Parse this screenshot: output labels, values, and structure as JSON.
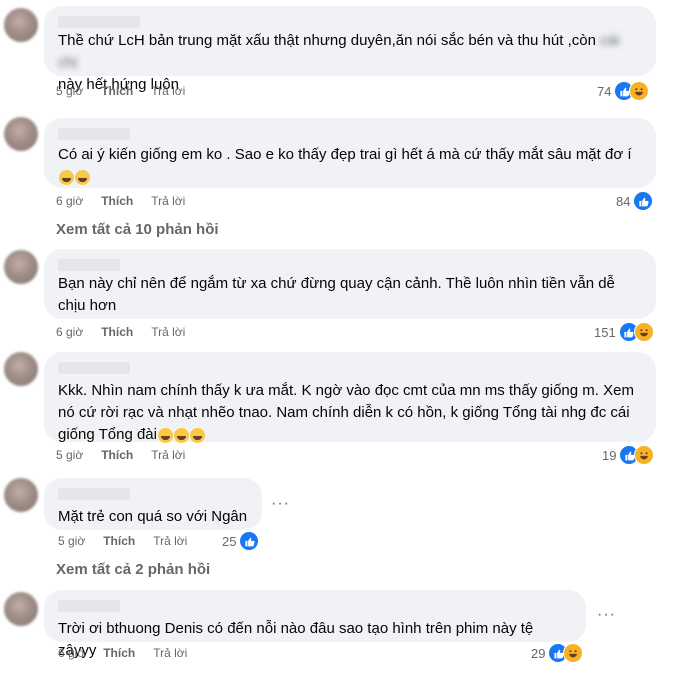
{
  "comments": [
    {
      "text": "Thề chứ LcH bản trung mặt xấu thật nhưng duyên,ăn nói sắc bén và thu hút ,còn",
      "text_blurred": "cái chị",
      "text2": "này hết hứng luôn",
      "time": "5 giờ",
      "like": "Thích",
      "reply": "Trả lời",
      "reaction_count": "74",
      "reactions": [
        "like-icon",
        "haha-icon"
      ]
    },
    {
      "text": "Có ai ý kiến giống em ko . Sao e ko thấy đẹp trai gì hết á mà cứ thấy mắt sâu mặt đơ í",
      "emojis": [
        "sad-icon",
        "sad-icon"
      ],
      "time": "6 giờ",
      "like": "Thích",
      "reply": "Trả lời",
      "reaction_count": "84",
      "reactions": [
        "like-icon"
      ]
    },
    {
      "text": "Bạn này chỉ nên để ngắm từ xa chứ đừng quay cận cảnh. Thề luôn nhìn tiền vẫn dễ chịu hơn",
      "time": "6 giờ",
      "like": "Thích",
      "reply": "Trả lời",
      "reaction_count": "151",
      "reactions": [
        "like-icon",
        "haha-icon"
      ]
    },
    {
      "text": "Kkk. Nhìn nam chính thấy k ưa mắt. K ngờ vào đọc cmt của mn ms thấy giống m. Xem nó cứ rời rạc và nhạt nhẽo tnao. Nam chính diễn k có hồn, k giống Tổng tài nhg đc cái giống Tổng đài",
      "emojis": [
        "grin-icon",
        "grin-icon",
        "grin-icon"
      ],
      "time": "5 giờ",
      "like": "Thích",
      "reply": "Trả lời",
      "reaction_count": "19",
      "reactions": [
        "like-icon",
        "haha-icon"
      ]
    },
    {
      "text": "Mặt trẻ con quá so với Ngân",
      "time": "5 giờ",
      "like": "Thích",
      "reply": "Trả lời",
      "reaction_count": "25",
      "reactions": [
        "like-icon"
      ]
    },
    {
      "text": "Trời ơi bthuong Denis có đến nỗi nào đâu sao tạo hình trên phim này tệ zậyyy",
      "time": "6 giờ",
      "like": "Thích",
      "reply": "Trả lời",
      "reaction_count": "29",
      "reactions": [
        "like-icon",
        "haha-icon"
      ]
    }
  ],
  "view_replies": [
    "Xem tất cả 10 phản hồi",
    "Xem tất cả 2 phản hồi"
  ],
  "more_glyph": "···",
  "colors": {
    "bubble": "#f0f2f5",
    "meta": "#65676b",
    "like": "#1877f2",
    "haha": "#f7b125"
  }
}
